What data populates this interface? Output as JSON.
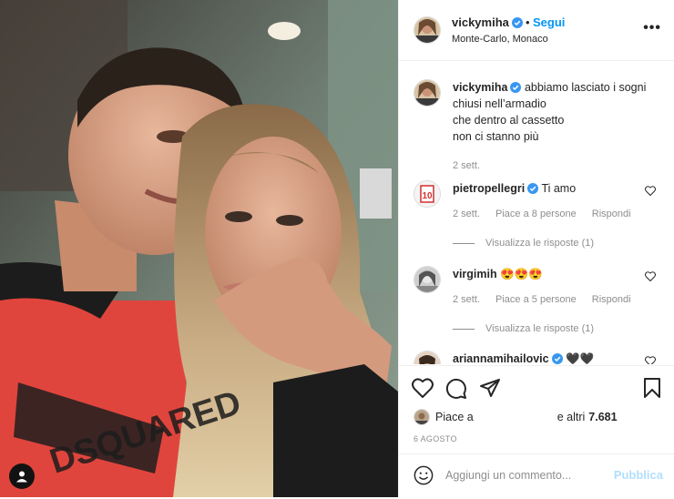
{
  "post": {
    "username": "vickymiha",
    "separator": "•",
    "follow_label": "Segui",
    "location": "Monte-Carlo, Monaco",
    "more_icon": "more-horizontal-icon"
  },
  "caption": {
    "username": "vickymiha",
    "lines": [
      "abbiamo lasciato i sogni",
      "chiusi nell’armadio",
      "che dentro al cassetto",
      "non ci stanno più"
    ],
    "time": "2 sett."
  },
  "comments": [
    {
      "username": "pietropellegri",
      "text": "Ti amo",
      "time": "2 sett.",
      "likes": "Piace a 8 persone",
      "reply": "Rispondi",
      "view_replies": "Visualizza le risposte (1)"
    },
    {
      "username": "virgimih",
      "text": "😍😍😍",
      "time": "2 sett.",
      "likes": "Piace a 5 persone",
      "reply": "Rispondi",
      "view_replies": "Visualizza le risposte (1)"
    },
    {
      "username": "ariannamihailovic",
      "text": "🖤🖤"
    }
  ],
  "actions": {
    "icons": [
      "heart-icon",
      "comment-icon",
      "share-icon",
      "bookmark-icon"
    ],
    "likes_prefix": "Piace a",
    "likes_suffix": "e altri",
    "likes_count": "7.681",
    "date": "6 AGOSTO"
  },
  "add_comment": {
    "placeholder": "Aggiungi un commento...",
    "publish_label": "Pubblica"
  },
  "colors": {
    "accent": "#0095f6",
    "publish_disabled": "#b2dffc",
    "muted": "#8e8e8e"
  }
}
